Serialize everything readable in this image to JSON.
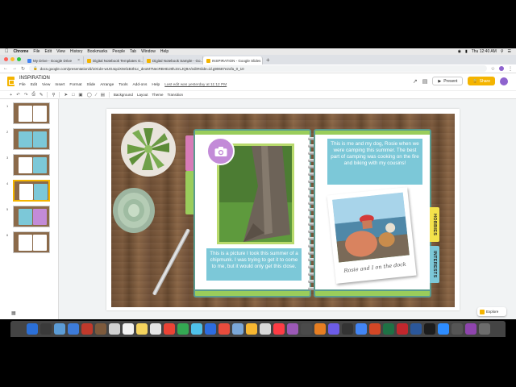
{
  "menubar": {
    "items": [
      "Chrome",
      "File",
      "Edit",
      "View",
      "History",
      "Bookmarks",
      "People",
      "Tab",
      "Window",
      "Help"
    ],
    "clock": "Thu 12:40 AM"
  },
  "browser": {
    "tabs": [
      {
        "label": "My Drive - Google Drive",
        "color": "#4285f4"
      },
      {
        "label": "Digital Notebook Templates G...",
        "color": "#f4b400"
      },
      {
        "label": "Digital Notebook Sample - Go...",
        "color": "#f4b400"
      },
      {
        "label": "INSPIRATION - Google Slides",
        "color": "#f4b400",
        "active": true
      }
    ],
    "new_tab": "+",
    "url": "docs.google.com/presentation/d/10Cde-wUG4qoiX0el1B3h1c_deoM7NecRBHDJ8hJzrLJQ9A/edit#slide=id.g90687e2ofa_0_10"
  },
  "slides_header": {
    "title": "INSPIRATION",
    "menu": [
      "File",
      "Edit",
      "View",
      "Insert",
      "Format",
      "Slide",
      "Arrange",
      "Tools",
      "Add-ons",
      "Help"
    ],
    "last_edit": "Last edit was yesterday at 11:12 PM",
    "present_label": "Present",
    "share_label": "Share"
  },
  "toolbar": {
    "background_label": "Background",
    "layout_label": "Layout",
    "theme_label": "Theme",
    "transition_label": "Transition"
  },
  "filmstrip": {
    "slides": [
      {
        "num": "1",
        "left_color": "#ffffff",
        "right_color": "#ffffff"
      },
      {
        "num": "2",
        "left_color": "#7cc8d8",
        "right_color": "#7cc8d8"
      },
      {
        "num": "3",
        "left_color": "#ffffff",
        "right_color": "#7cc8d8"
      },
      {
        "num": "4",
        "left_color": "#ffffff",
        "right_color": "#7cc8d8",
        "selected": true
      },
      {
        "num": "5",
        "left_color": "#7cc8d8",
        "right_color": "#c38bd8"
      },
      {
        "num": "6",
        "left_color": "#ffffff",
        "right_color": "#ffffff"
      }
    ]
  },
  "slide": {
    "caption_left": "This is a picture I took this summer of a chipmunk. I was trying to get it to come to me, but it would only get this close.",
    "caption_right": "This is me and my dog, Rosie when we were camping this summer. The best part of camping was cooking on the fire and biking with my cousins!",
    "polaroid_caption": "Rosie and I on the dock",
    "tab_hobbies": "HOBBIES",
    "tab_interests": "INTERESTS",
    "colors": {
      "teal_box": "#7cc8d8",
      "green_accent": "#9acd5b",
      "pink_tab": "#d77bb7",
      "yellow_tab": "#f3e24b",
      "purple_badge": "#c38bd8"
    }
  },
  "explore_label": "Explore",
  "dock": {
    "icons": [
      "#2b6fd6",
      "#3a3a3a",
      "#5b9bd5",
      "#3d7bd8",
      "#c0392b",
      "#7d5a3c",
      "#d0d0d0",
      "#f2f2f2",
      "#f4d35e",
      "#e6e6e6",
      "#ea4335",
      "#34a853",
      "#4fc1e9",
      "#2d6cdf",
      "#e84c3d",
      "#7aa7d8",
      "#f7b731",
      "#d9d9d9",
      "#fc3c44",
      "#9b59b6",
      "#4a4a4a",
      "#e67e22",
      "#6c5ce7",
      "#333333",
      "#4285f4",
      "#d24726",
      "#1e7145",
      "#c1272d",
      "#2b579a",
      "#1c1c1c",
      "#2d8cff",
      "#555555",
      "#8e44ad",
      "#6c6c6c"
    ]
  }
}
